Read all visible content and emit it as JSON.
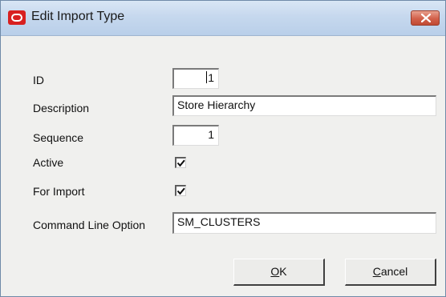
{
  "window": {
    "title": "Edit Import Type"
  },
  "form": {
    "id": {
      "label": "ID",
      "value": "1"
    },
    "description": {
      "label": "Description",
      "value": "Store Hierarchy"
    },
    "sequence": {
      "label": "Sequence",
      "value": "1"
    },
    "active": {
      "label": "Active",
      "checked": true
    },
    "for_import": {
      "label": "For Import",
      "checked": true
    },
    "command_line_option": {
      "label": "Command Line Option",
      "value": "SM_CLUSTERS"
    }
  },
  "buttons": {
    "ok": {
      "mnemonic": "O",
      "rest": "K"
    },
    "cancel": {
      "mnemonic": "C",
      "rest": "ancel"
    }
  },
  "icons": {
    "app": "oracle-logo-icon",
    "close": "close-icon",
    "check": "check-icon"
  },
  "colors": {
    "titlebar": "#c6d8ee",
    "close_button": "#d2604a",
    "app_icon": "#d82020",
    "dialog_background": "#f0f0ee"
  }
}
